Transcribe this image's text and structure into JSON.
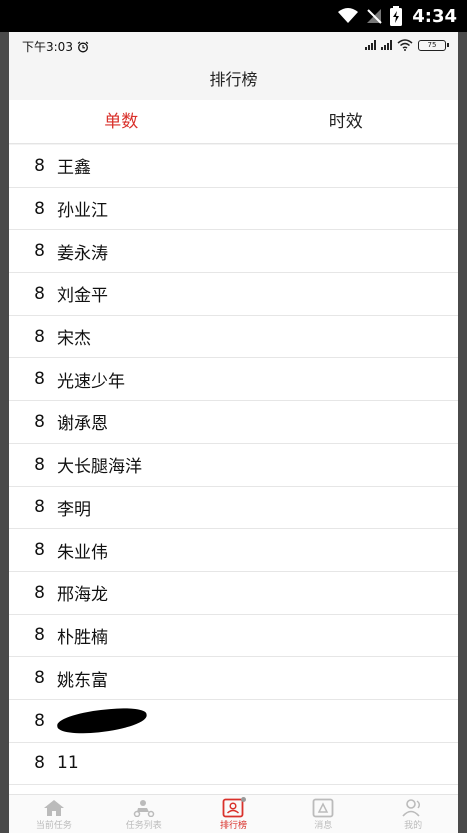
{
  "system": {
    "time": "4:34"
  },
  "inner_status": {
    "time": "下午3:03",
    "battery": "75"
  },
  "header": {
    "title": "排行榜"
  },
  "tabs": [
    {
      "label": "单数",
      "active": true
    },
    {
      "label": "时效",
      "active": false
    }
  ],
  "rows": [
    {
      "num": "8",
      "name": "王鑫"
    },
    {
      "num": "8",
      "name": "孙业江"
    },
    {
      "num": "8",
      "name": "姜永涛"
    },
    {
      "num": "8",
      "name": "刘金平"
    },
    {
      "num": "8",
      "name": "宋杰"
    },
    {
      "num": "8",
      "name": "光速少年"
    },
    {
      "num": "8",
      "name": "谢承恩"
    },
    {
      "num": "8",
      "name": "大长腿海洋"
    },
    {
      "num": "8",
      "name": "李明"
    },
    {
      "num": "8",
      "name": "朱业伟"
    },
    {
      "num": "8",
      "name": "邢海龙"
    },
    {
      "num": "8",
      "name": "朴胜楠"
    },
    {
      "num": "8",
      "name": "姚东富"
    },
    {
      "num": "8",
      "name": "",
      "redacted": true
    },
    {
      "num": "8",
      "name": "11"
    },
    {
      "num": "",
      "name": ""
    }
  ],
  "nav": [
    {
      "label": "当前任务",
      "icon": "home-icon"
    },
    {
      "label": "任务列表",
      "icon": "courier-icon"
    },
    {
      "label": "排行榜",
      "icon": "ranking-icon",
      "active": true
    },
    {
      "label": "消息",
      "icon": "message-icon"
    },
    {
      "label": "我的",
      "icon": "profile-icon"
    }
  ],
  "colors": {
    "accent": "#d9312b"
  }
}
